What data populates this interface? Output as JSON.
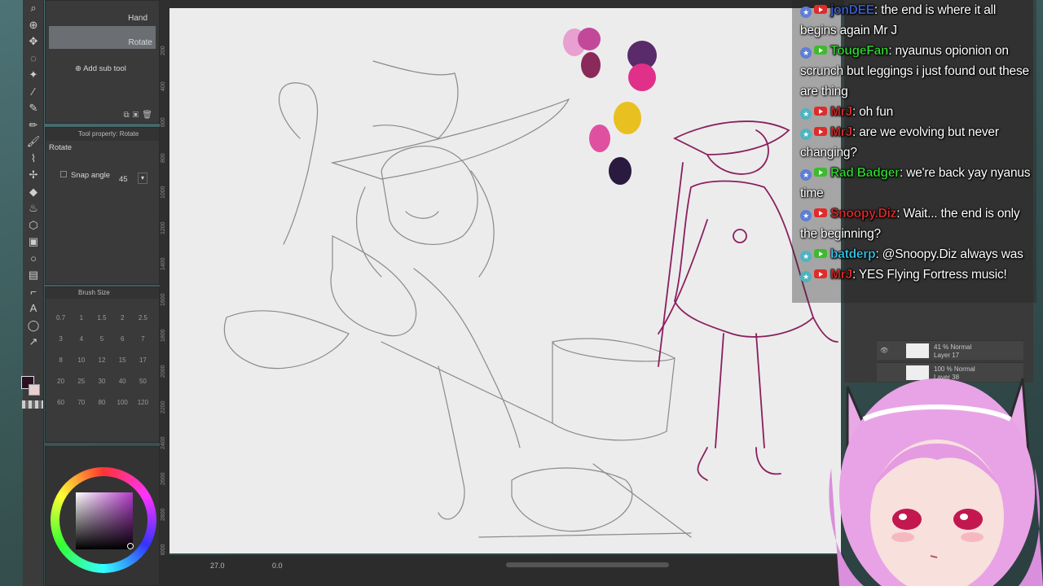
{
  "subtool_panel": {
    "hand_label": "Hand",
    "rotate_label": "Rotate",
    "add_sub_tool": "Add sub tool"
  },
  "tool_property": {
    "title": "Tool property: Rotate",
    "tool_name": "Rotate",
    "snap_angle_label": "Snap angle",
    "snap_angle_value": "45"
  },
  "brush_size": {
    "title": "Brush Size",
    "sizes": [
      "0.7",
      "1",
      "1.5",
      "2",
      "2.5",
      "3",
      "4",
      "5",
      "6",
      "7",
      "8",
      "10",
      "12",
      "15",
      "17",
      "20",
      "25",
      "30",
      "40",
      "50",
      "60",
      "70",
      "80",
      "100",
      "120"
    ]
  },
  "ruler_marks": [
    "200",
    "400",
    "600",
    "800",
    "1000",
    "1200",
    "1400",
    "1600",
    "1800",
    "2000",
    "2200",
    "2400",
    "2600",
    "2800",
    "3000"
  ],
  "status_bar": {
    "zoom": "27.0",
    "rotation": "0.0"
  },
  "layers": [
    {
      "opacity_mode": "41 % Normal",
      "name": "Layer 17"
    },
    {
      "opacity_mode": "100 % Normal",
      "name": "Layer 38"
    }
  ],
  "chat": [
    {
      "user": "jonDEE",
      "user_color": "#3a62d8",
      "badge": "star",
      "platform": "youtube",
      "text": "the end is where it all begins again Mr J"
    },
    {
      "user": "TougeFan",
      "user_color": "#2fd62f",
      "badge": "star",
      "platform": "twitch",
      "text": "nyaunus opionion on scrunch but leggings i just found out these are thing"
    },
    {
      "user": "MrJ",
      "user_color": "#e02b2b",
      "badge": "teal",
      "platform": "youtube",
      "text": "oh fun"
    },
    {
      "user": "MrJ",
      "user_color": "#e02b2b",
      "badge": "teal",
      "platform": "youtube",
      "text": "are we evolving but never changing?"
    },
    {
      "user": "Rad Badger",
      "user_color": "#2fd62f",
      "badge": "star",
      "platform": "twitch",
      "text": "we're back yay nyanus time"
    },
    {
      "user": "Snoopy.Diz",
      "user_color": "#e02b2b",
      "badge": "star",
      "platform": "youtube",
      "text": "Wait... the end is only the beginning?"
    },
    {
      "user": "batderp",
      "user_color": "#38c9ee",
      "badge": "teal",
      "platform": "twitch",
      "text": "@Snoopy.Diz always was"
    },
    {
      "user": "MrJ",
      "user_color": "#e02b2b",
      "badge": "teal",
      "platform": "youtube",
      "text": "YES Flying Fortress music!"
    }
  ],
  "palette_colors": [
    "#e8a0d0",
    "#c2499a",
    "#8a2a5a",
    "#5a2a6a",
    "#e0308a",
    "#e8c020",
    "#e050a0",
    "#2a1a40"
  ],
  "foreground_color": "#2b1024"
}
